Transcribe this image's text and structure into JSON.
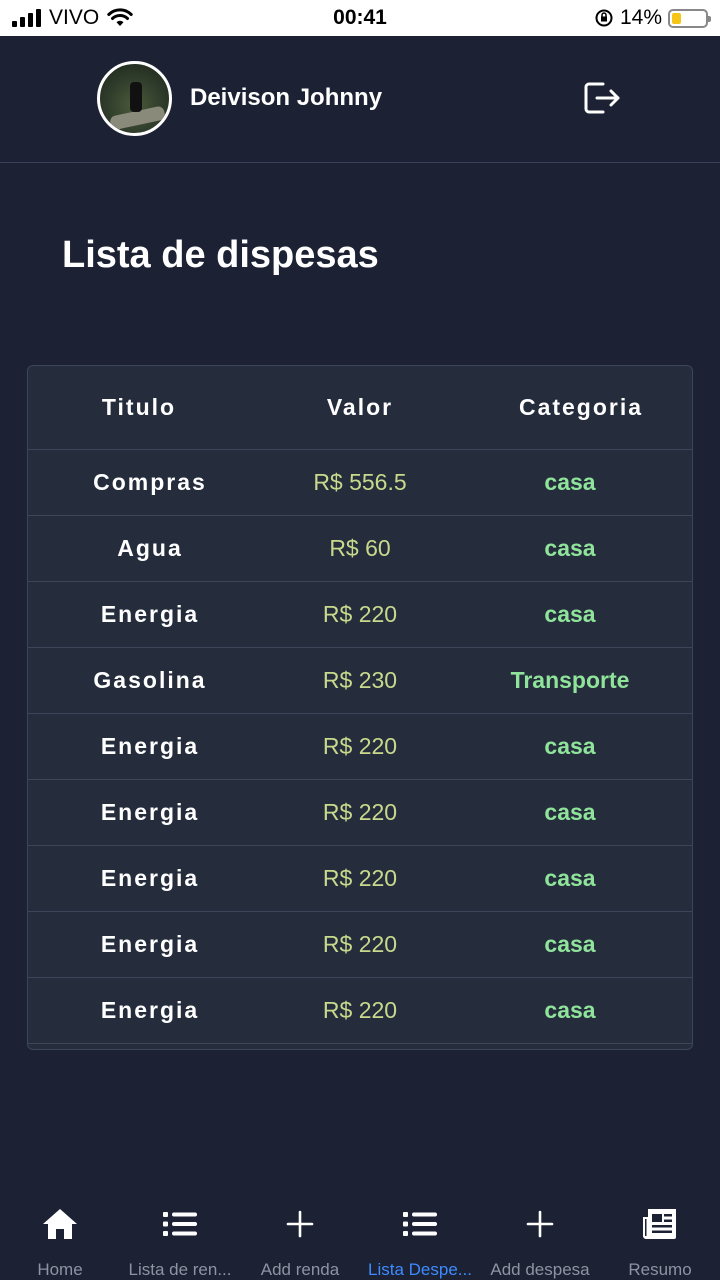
{
  "status_bar": {
    "carrier": "VIVO",
    "time": "00:41",
    "battery": "14%"
  },
  "header": {
    "username": "Deivison Johnny"
  },
  "page": {
    "title": "Lista de dispesas"
  },
  "table": {
    "headers": {
      "title": "Titulo",
      "value": "Valor",
      "category": "Categoria"
    },
    "rows": [
      {
        "title": "Compras",
        "value": "R$ 556.5",
        "category": "casa"
      },
      {
        "title": "Agua",
        "value": "R$ 60",
        "category": "casa"
      },
      {
        "title": "Energia",
        "value": "R$ 220",
        "category": "casa"
      },
      {
        "title": "Gasolina",
        "value": "R$ 230",
        "category": "Transporte"
      },
      {
        "title": "Energia",
        "value": "R$ 220",
        "category": "casa"
      },
      {
        "title": "Energia",
        "value": "R$ 220",
        "category": "casa"
      },
      {
        "title": "Energia",
        "value": "R$ 220",
        "category": "casa"
      },
      {
        "title": "Energia",
        "value": "R$ 220",
        "category": "casa"
      },
      {
        "title": "Energia",
        "value": "R$ 220",
        "category": "casa"
      }
    ]
  },
  "tabs": [
    {
      "label": "Home",
      "icon": "home-icon"
    },
    {
      "label": "Lista de ren...",
      "icon": "list-icon"
    },
    {
      "label": "Add renda",
      "icon": "plus-icon"
    },
    {
      "label": "Lista Despe...",
      "icon": "list-icon",
      "active": true
    },
    {
      "label": "Add despesa",
      "icon": "plus-icon"
    },
    {
      "label": "Resumo",
      "icon": "newspaper-icon"
    }
  ],
  "colors": {
    "background": "#1c2233",
    "card": "#252d3d",
    "value": "#c9d98c",
    "category": "#8fe39a",
    "active_tab": "#3d8bff"
  }
}
